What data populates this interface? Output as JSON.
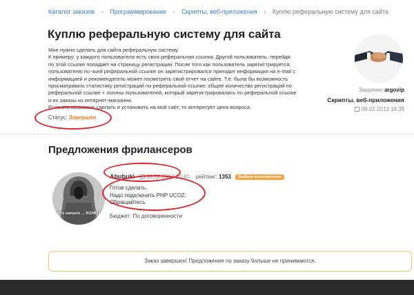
{
  "breadcrumb": {
    "items": [
      "Каталог заказов",
      "Программирование",
      "Скрипты, веб-приложения"
    ],
    "current": "Куплю реферальную систему для сайта"
  },
  "job": {
    "title": "Куплю реферальную систему для сайта",
    "description_lines": [
      "Мне нужно сделать для сайта реферальную систему.",
      "К примеру: у каждого пользователя есть своя реферальная ссылка. Другой пользователь, перейдя",
      "по этой ссылке попадает на страницу регистрации. После того как пользователь зарегистрируется,",
      "пользователю по чьей реферальной ссылке он зарегистрировался приходит информация на e-mail с",
      "информацией и рекомендатель может посмотреть свой отчет на сайте. Т.е. была бы возможность",
      "просматривать статистику регистраций по реферальной ссылке: общее количество регистраций по",
      "реферальной ссылке + логины пользователей, который зарегистрировались по реферальной ссылке",
      "и их заказы из интернет-магазина.",
      "Если это возможно сделать и установить на мой сайт, то интересует цена вопроса."
    ],
    "status_label": "Статус:",
    "status_value": "Завершен",
    "status_color": "#e67e22"
  },
  "client": {
    "label": "Заказчик:",
    "name": "argovip",
    "category": "Скрипты, веб-приложения",
    "date": "08.02.2013 19:39",
    "calendar_icon": "calendar-icon"
  },
  "offers": {
    "title": "Предложения фрилансеров",
    "items": [
      {
        "username": "Abubuki",
        "date": "08.02.2013 20:40",
        "rating_label": "рейтинг:",
        "rating_value": "1353",
        "badge": "Выбран исполнителем",
        "avatar_caption": "Это начало ... КОНЕЦ",
        "message_lines": [
          "Готов сделать.",
          "Надо подключить PHP UCOZ.",
          "Обращайтесь"
        ],
        "budget": "Бюджет: По договоренности"
      }
    ]
  },
  "notice": {
    "text": "Заказ завершен! Предложения по заказу больше не принимаются.",
    "border_color": "#f0c36d"
  },
  "colors": {
    "link": "#3b7fc4",
    "accent": "#f4a340",
    "annotation": "#d9262c",
    "footer": "#2a2a2a"
  }
}
